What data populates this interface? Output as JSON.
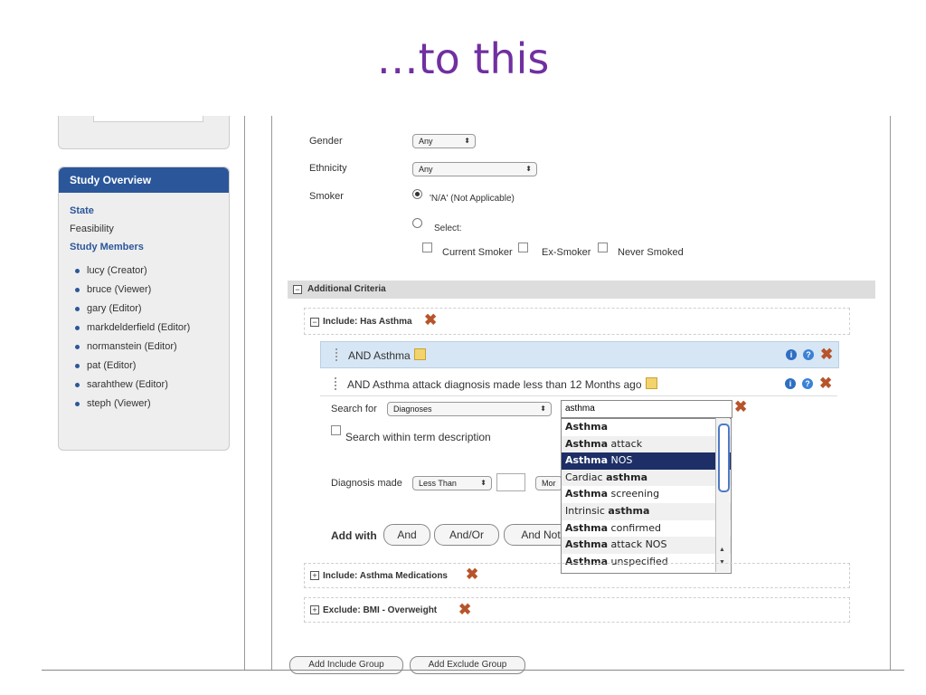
{
  "slide_title": "…to this",
  "sidebar": {
    "heading": "Study Overview",
    "links": [
      {
        "label": "State",
        "style": "bold"
      },
      {
        "label": "Feasibility",
        "style": "plain"
      },
      {
        "label": "Study Members",
        "style": "bold"
      }
    ],
    "members": [
      "lucy (Creator)",
      "bruce (Viewer)",
      "gary (Editor)",
      "markdelderfield (Editor)",
      "normanstein (Editor)",
      "pat (Editor)",
      "sarahthew (Editor)",
      "steph (Viewer)"
    ]
  },
  "form": {
    "gender": {
      "label": "Gender",
      "value": "Any"
    },
    "ethnicity": {
      "label": "Ethnicity",
      "value": "Any"
    },
    "smoker": {
      "label": "Smoker",
      "options": [
        "'N/A' (Not Applicable)",
        "Select:"
      ],
      "selected": 0,
      "checkboxes": [
        "Current Smoker",
        "Ex-Smoker",
        "Never Smoked"
      ]
    }
  },
  "additional": {
    "title": "Additional Criteria",
    "groups": [
      {
        "title": "Include: Has Asthma",
        "expanded": true
      },
      {
        "title": "Include: Asthma Medications",
        "expanded": false
      },
      {
        "title": "Exclude: BMI - Overweight",
        "expanded": false
      }
    ],
    "criteria": [
      {
        "text": "AND Asthma",
        "highlighted": true
      },
      {
        "text": "AND Asthma attack diagnosis made less than 12 Months ago",
        "highlighted": false
      }
    ],
    "search": {
      "label": "Search for",
      "type_value": "Diagnoses",
      "query": "asthma",
      "within_desc": "Search within term description"
    },
    "diagnosis_made": {
      "label": "Diagnosis made",
      "comparator": "Less Than",
      "amount": "",
      "unit_partial": "Mor"
    },
    "add_with": {
      "label": "Add with",
      "buttons": [
        "And",
        "And/Or",
        "And Not"
      ]
    }
  },
  "autocomplete": {
    "items": [
      {
        "bold": "Asthma",
        "rest": ""
      },
      {
        "bold": "Asthma",
        "rest": " attack"
      },
      {
        "bold": "Asthma",
        "rest": " NOS"
      },
      {
        "pre": "Cardiac ",
        "bold": "asthma",
        "rest": ""
      },
      {
        "bold": "Asthma",
        "rest": " screening"
      },
      {
        "pre": "Intrinsic ",
        "bold": "asthma",
        "rest": ""
      },
      {
        "bold": "Asthma",
        "rest": " confirmed"
      },
      {
        "bold": "Asthma",
        "rest": " attack NOS"
      },
      {
        "bold": "Asthma",
        "rest": " unspecified"
      }
    ],
    "selected_index": 2
  },
  "footer_buttons": [
    "Add Include Group",
    "Add Exclude Group"
  ],
  "colors": {
    "title": "#7030a0",
    "panel_head": "#2b579a",
    "selected_row": "#1d2f66",
    "remove": "#b7542a"
  }
}
